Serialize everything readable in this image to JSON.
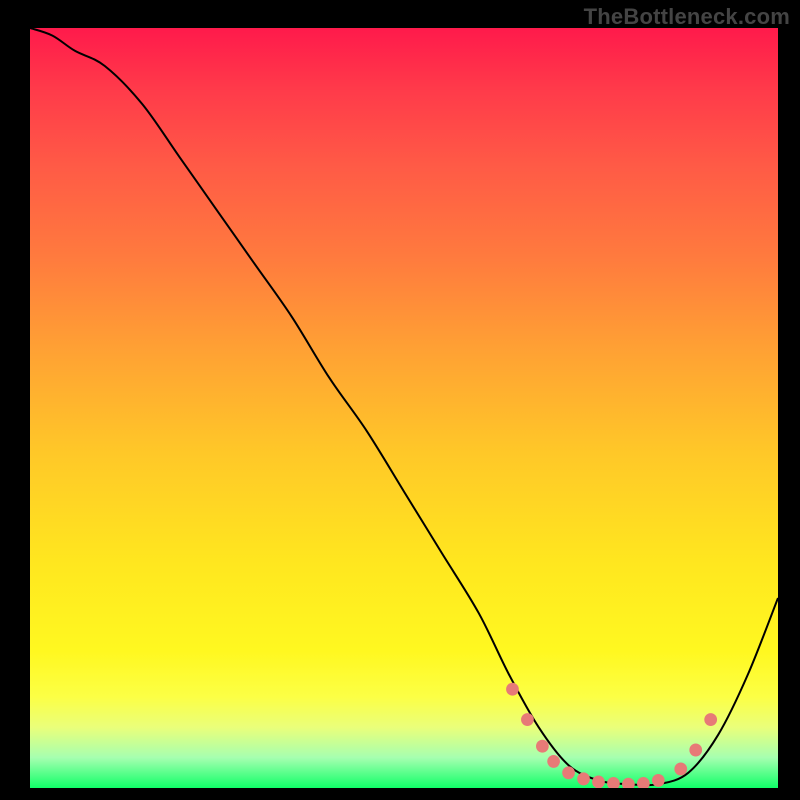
{
  "watermark": "TheBottleneck.com",
  "chart_data": {
    "type": "line",
    "title": "",
    "xlabel": "",
    "ylabel": "",
    "xlim": [
      0,
      100
    ],
    "ylim": [
      0,
      100
    ],
    "grid": false,
    "background_gradient": {
      "direction": "top-to-bottom",
      "stops": [
        {
          "pos": 0,
          "color": "#ff1a4b"
        },
        {
          "pos": 50,
          "color": "#ffc024"
        },
        {
          "pos": 85,
          "color": "#fff820"
        },
        {
          "pos": 100,
          "color": "#10ff68"
        }
      ],
      "meaning": "red = high bottleneck, green = low bottleneck"
    },
    "series": [
      {
        "name": "bottleneck-curve",
        "color": "#000000",
        "x": [
          0,
          3,
          6,
          10,
          15,
          20,
          25,
          30,
          35,
          40,
          45,
          50,
          55,
          60,
          64,
          68,
          72,
          76,
          80,
          84,
          88,
          92,
          96,
          100
        ],
        "y": [
          100,
          99,
          97,
          95,
          90,
          83,
          76,
          69,
          62,
          54,
          47,
          39,
          31,
          23,
          15,
          8,
          3,
          1,
          0.5,
          0.5,
          2,
          7,
          15,
          25
        ]
      }
    ],
    "markers": {
      "name": "highlight-dots",
      "color": "#e77a77",
      "points": [
        {
          "x": 64.5,
          "y": 13
        },
        {
          "x": 66.5,
          "y": 9
        },
        {
          "x": 68.5,
          "y": 5.5
        },
        {
          "x": 70,
          "y": 3.5
        },
        {
          "x": 72,
          "y": 2
        },
        {
          "x": 74,
          "y": 1.2
        },
        {
          "x": 76,
          "y": 0.8
        },
        {
          "x": 78,
          "y": 0.6
        },
        {
          "x": 80,
          "y": 0.5
        },
        {
          "x": 82,
          "y": 0.6
        },
        {
          "x": 84,
          "y": 1
        },
        {
          "x": 87,
          "y": 2.5
        },
        {
          "x": 89,
          "y": 5
        },
        {
          "x": 91,
          "y": 9
        }
      ]
    }
  }
}
